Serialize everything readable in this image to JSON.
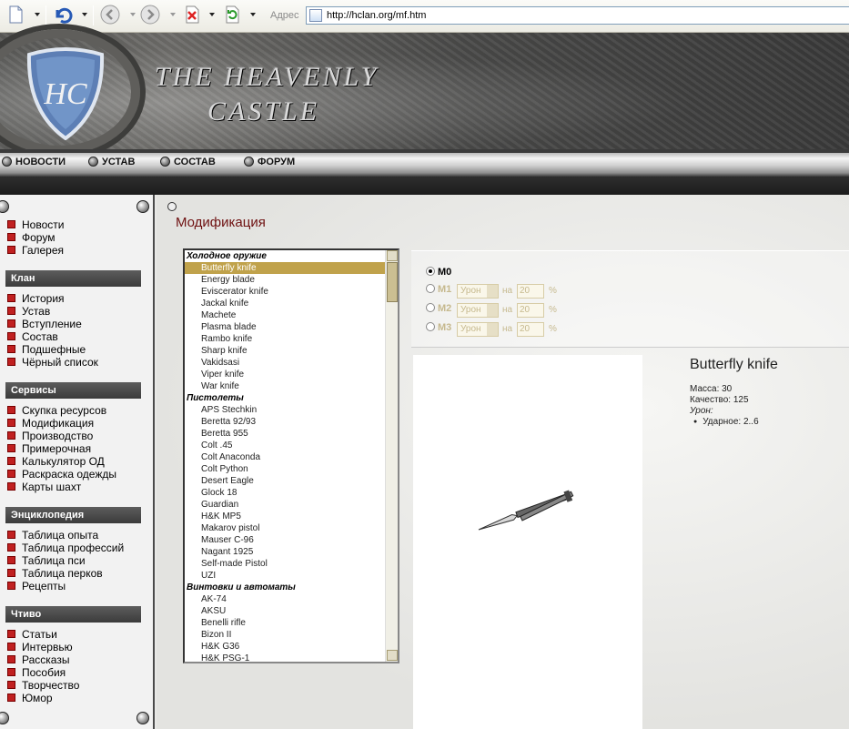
{
  "browser": {
    "address_label": "Адрес",
    "url": "http://hclan.org/mf.htm"
  },
  "banner": {
    "title_line1": "THE HEAVENLY",
    "title_line2": "CASTLE",
    "logo_letters": "HC"
  },
  "topnav": [
    "НОВОСТИ",
    "УСТАВ",
    "СОСТАВ",
    "ФОРУМ"
  ],
  "sidebar": {
    "main": [
      "Новости",
      "Форум",
      "Галерея"
    ],
    "sections": [
      {
        "title": "Клан",
        "items": [
          "История",
          "Устав",
          "Вступление",
          "Состав",
          "Подшефные",
          "Чёрный список"
        ]
      },
      {
        "title": "Сервисы",
        "items": [
          "Скупка ресурсов",
          "Модификация",
          "Производство",
          "Примерочная",
          "Калькулятор ОД",
          "Раскраска одежды",
          "Карты шахт"
        ]
      },
      {
        "title": "Энциклопедия",
        "items": [
          "Таблица опыта",
          "Таблица профессий",
          "Таблица пси",
          "Таблица перков",
          "Рецепты"
        ]
      },
      {
        "title": "Чтиво",
        "items": [
          "Статьи",
          "Интервью",
          "Рассказы",
          "Пособия",
          "Творчество",
          "Юмор"
        ]
      }
    ]
  },
  "content": {
    "title": "Модификация",
    "list": [
      {
        "group": "Холодное оружие"
      },
      {
        "item": "Butterfly knife",
        "selected": true
      },
      {
        "item": "Energy blade"
      },
      {
        "item": "Eviscerator knife"
      },
      {
        "item": "Jackal knife"
      },
      {
        "item": "Machete"
      },
      {
        "item": "Plasma blade"
      },
      {
        "item": "Rambo knife"
      },
      {
        "item": "Sharp knife"
      },
      {
        "item": "Vakidsasi"
      },
      {
        "item": "Viper knife"
      },
      {
        "item": "War knife"
      },
      {
        "group": "Пистолеты"
      },
      {
        "item": "APS Stechkin"
      },
      {
        "item": "Beretta 92/93"
      },
      {
        "item": "Beretta 955"
      },
      {
        "item": "Colt .45"
      },
      {
        "item": "Colt Anaconda"
      },
      {
        "item": "Colt Python"
      },
      {
        "item": "Desert Eagle"
      },
      {
        "item": "Glock 18"
      },
      {
        "item": "Guardian"
      },
      {
        "item": "H&K MP5"
      },
      {
        "item": "Makarov pistol"
      },
      {
        "item": "Mauser C-96"
      },
      {
        "item": "Nagant 1925"
      },
      {
        "item": "Self-made Pistol"
      },
      {
        "item": "UZI"
      },
      {
        "group": "Винтовки и автоматы"
      },
      {
        "item": "AK-74"
      },
      {
        "item": "AKSU"
      },
      {
        "item": "Benelli rifle"
      },
      {
        "item": "Bizon II"
      },
      {
        "item": "H&K G36"
      },
      {
        "item": "H&K PSG-1"
      }
    ],
    "mods": {
      "m0": "M0",
      "rows": [
        {
          "label": "M1",
          "select": "Урон",
          "na": "на",
          "value": "20",
          "pct": "%"
        },
        {
          "label": "M2",
          "select": "Урон",
          "na": "на",
          "value": "20",
          "pct": "%"
        },
        {
          "label": "M3",
          "select": "Урон",
          "na": "на",
          "value": "20",
          "pct": "%"
        }
      ]
    },
    "item": {
      "name": "Butterfly knife",
      "mass": "Масса: 30",
      "quality": "Качество: 125",
      "damage_label": "Урон:",
      "damage": "Ударное: 2..6"
    }
  }
}
